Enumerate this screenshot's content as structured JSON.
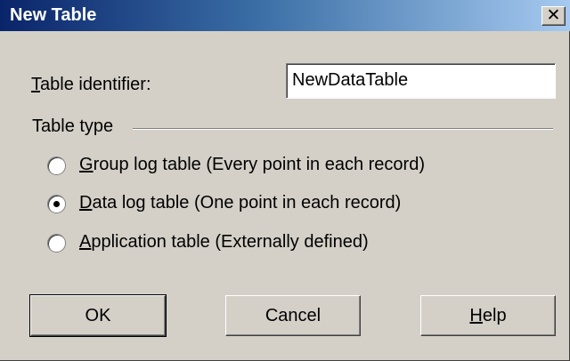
{
  "window": {
    "title": "New Table",
    "close_glyph": "✕"
  },
  "identifier": {
    "label_accel": "T",
    "label_rest": "able identifier:",
    "value": "NewDataTable"
  },
  "table_type": {
    "group_label": "Table type",
    "options": [
      {
        "accel": "G",
        "rest": "roup log table (Every point in each record)",
        "selected": false
      },
      {
        "accel": "D",
        "rest": "ata log table (One point in each record)",
        "selected": true
      },
      {
        "accel": "A",
        "rest": "pplication table (Externally defined)",
        "selected": false
      }
    ]
  },
  "buttons": {
    "ok": "OK",
    "cancel": "Cancel",
    "help_accel": "H",
    "help_rest": "elp"
  },
  "colors": {
    "titlebar_start": "#0a246a",
    "titlebar_end": "#a6caf0",
    "face": "#d4d0c8"
  }
}
